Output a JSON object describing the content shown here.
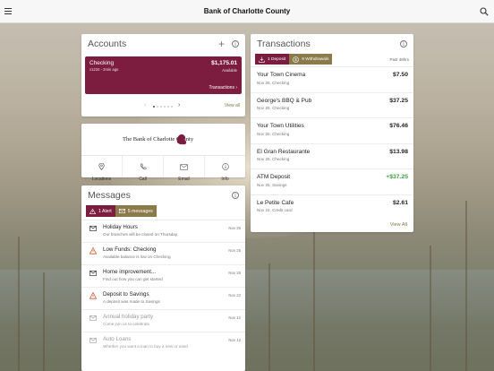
{
  "app": {
    "title": "Bank of Charlotte County"
  },
  "colors": {
    "brand": "#7c1d3f",
    "accent": "#8b7a4a",
    "positive": "#3f9a3f"
  },
  "accounts": {
    "heading": "Accounts",
    "tile": {
      "name": "Checking",
      "sub": "x1234 - 2min ago",
      "amount": "$1,175.01",
      "available_label": "Available",
      "transactions_link": "Transactions"
    },
    "view_all": "View all"
  },
  "bank": {
    "logo_text": "The Bank of Charlotte County",
    "actions": [
      {
        "label": "Locations",
        "icon": "location-pin-icon"
      },
      {
        "label": "Call",
        "icon": "phone-icon"
      },
      {
        "label": "Email",
        "icon": "mail-icon"
      },
      {
        "label": "Info",
        "icon": "info-icon"
      }
    ]
  },
  "messages": {
    "heading": "Messages",
    "tabs": {
      "alerts": "1 Alert",
      "messages": "5 messages"
    },
    "items": [
      {
        "title": "Holiday Hours",
        "sub": "Our branches will be closed on Thursday.",
        "date": "Nov 25",
        "icon": "mail-icon",
        "read": false
      },
      {
        "title": "Low Funds: Checking",
        "sub": "Available balance is low on Checking",
        "date": "Nov 25",
        "icon": "warning-icon",
        "read": false
      },
      {
        "title": "Home improvement...",
        "sub": "Find out how you can get started",
        "date": "Nov 25",
        "icon": "mail-icon",
        "read": false
      },
      {
        "title": "Deposit to Savings",
        "sub": "A deposit was made to Savings",
        "date": "Nov 22",
        "icon": "warning-icon",
        "read": false
      },
      {
        "title": "Annual holiday party",
        "sub": "Come join us to celebrate",
        "date": "Nov 12",
        "icon": "mail-icon",
        "read": true
      },
      {
        "title": "Auto Loans",
        "sub": "Whether you want a loan to buy a new or used",
        "date": "Nov 12",
        "icon": "mail-icon",
        "read": true
      }
    ]
  },
  "transactions": {
    "heading": "Transactions",
    "tabs": {
      "deposits": "1 Deposit",
      "withdrawals": "9 Withdrawals"
    },
    "period": "Past 48hrs",
    "items": [
      {
        "name": "Your Town Cinema",
        "date": "Nov 25, Checking",
        "amount": "$7.50",
        "positive": false
      },
      {
        "name": "George's BBQ & Pub",
        "date": "Nov 25, Checking",
        "amount": "$37.25",
        "positive": false
      },
      {
        "name": "Your Town Utilities",
        "date": "Nov 25, Checking",
        "amount": "$76.46",
        "positive": false
      },
      {
        "name": "El Gran Restaurante",
        "date": "Nov 25, Checking",
        "amount": "$13.98",
        "positive": false
      },
      {
        "name": "ATM Deposit",
        "date": "Nov 25, Savings",
        "amount": "+$37.25",
        "positive": true
      },
      {
        "name": "Le Petite Cafe",
        "date": "Nov 24, Credit card",
        "amount": "$2.61",
        "positive": false
      }
    ],
    "view_all": "View All"
  }
}
